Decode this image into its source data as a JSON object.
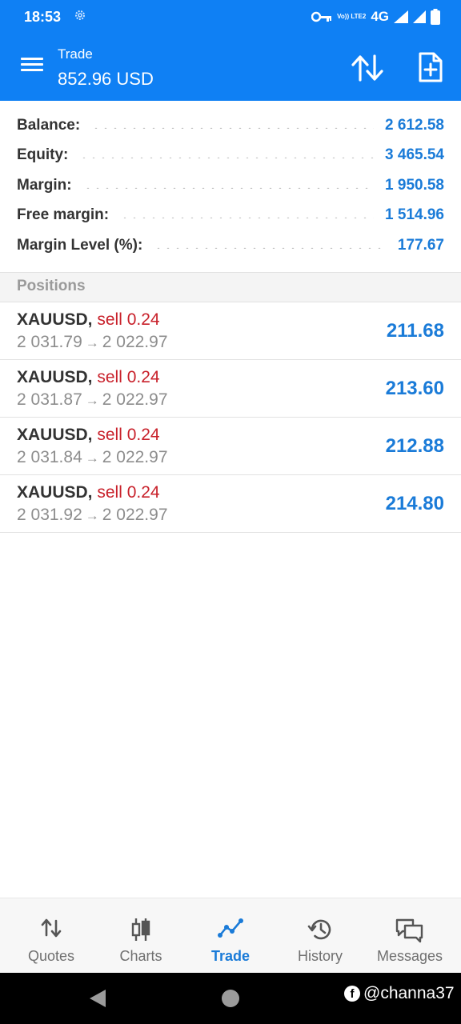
{
  "status_bar": {
    "time": "18:53",
    "lte_label": "Vo)) LTE2",
    "network": "4G"
  },
  "app_bar": {
    "subtitle": "Trade",
    "title": "852.96 USD"
  },
  "account_summary": [
    {
      "label": "Balance:",
      "value": "2 612.58"
    },
    {
      "label": "Equity:",
      "value": "3 465.54"
    },
    {
      "label": "Margin:",
      "value": "1 950.58"
    },
    {
      "label": "Free margin:",
      "value": "1 514.96"
    },
    {
      "label": "Margin Level (%):",
      "value": "177.67"
    }
  ],
  "positions_header": "Positions",
  "positions": [
    {
      "symbol": "XAUUSD,",
      "side": "sell 0.24",
      "open_price": "2 031.79",
      "current_price": "2 022.97",
      "arrow": "→",
      "profit": "211.68"
    },
    {
      "symbol": "XAUUSD,",
      "side": "sell 0.24",
      "open_price": "2 031.87",
      "current_price": "2 022.97",
      "arrow": "→",
      "profit": "213.60"
    },
    {
      "symbol": "XAUUSD,",
      "side": "sell 0.24",
      "open_price": "2 031.84",
      "current_price": "2 022.97",
      "arrow": "→",
      "profit": "212.88"
    },
    {
      "symbol": "XAUUSD,",
      "side": "sell 0.24",
      "open_price": "2 031.92",
      "current_price": "2 022.97",
      "arrow": "→",
      "profit": "214.80"
    }
  ],
  "bottom_nav": [
    {
      "label": "Quotes",
      "icon": "quotes-icon",
      "active": false
    },
    {
      "label": "Charts",
      "icon": "charts-icon",
      "active": false
    },
    {
      "label": "Trade",
      "icon": "trade-icon",
      "active": true
    },
    {
      "label": "History",
      "icon": "history-icon",
      "active": false
    },
    {
      "label": "Messages",
      "icon": "messages-icon",
      "active": false
    }
  ],
  "watermark": {
    "fb_glyph": "f",
    "handle": "@channa37"
  },
  "colors": {
    "app_bar": "#0f80f4",
    "accent_blue": "#1a7bd8",
    "sell_red": "#c8202a",
    "muted_gray": "#8d8d8d"
  }
}
